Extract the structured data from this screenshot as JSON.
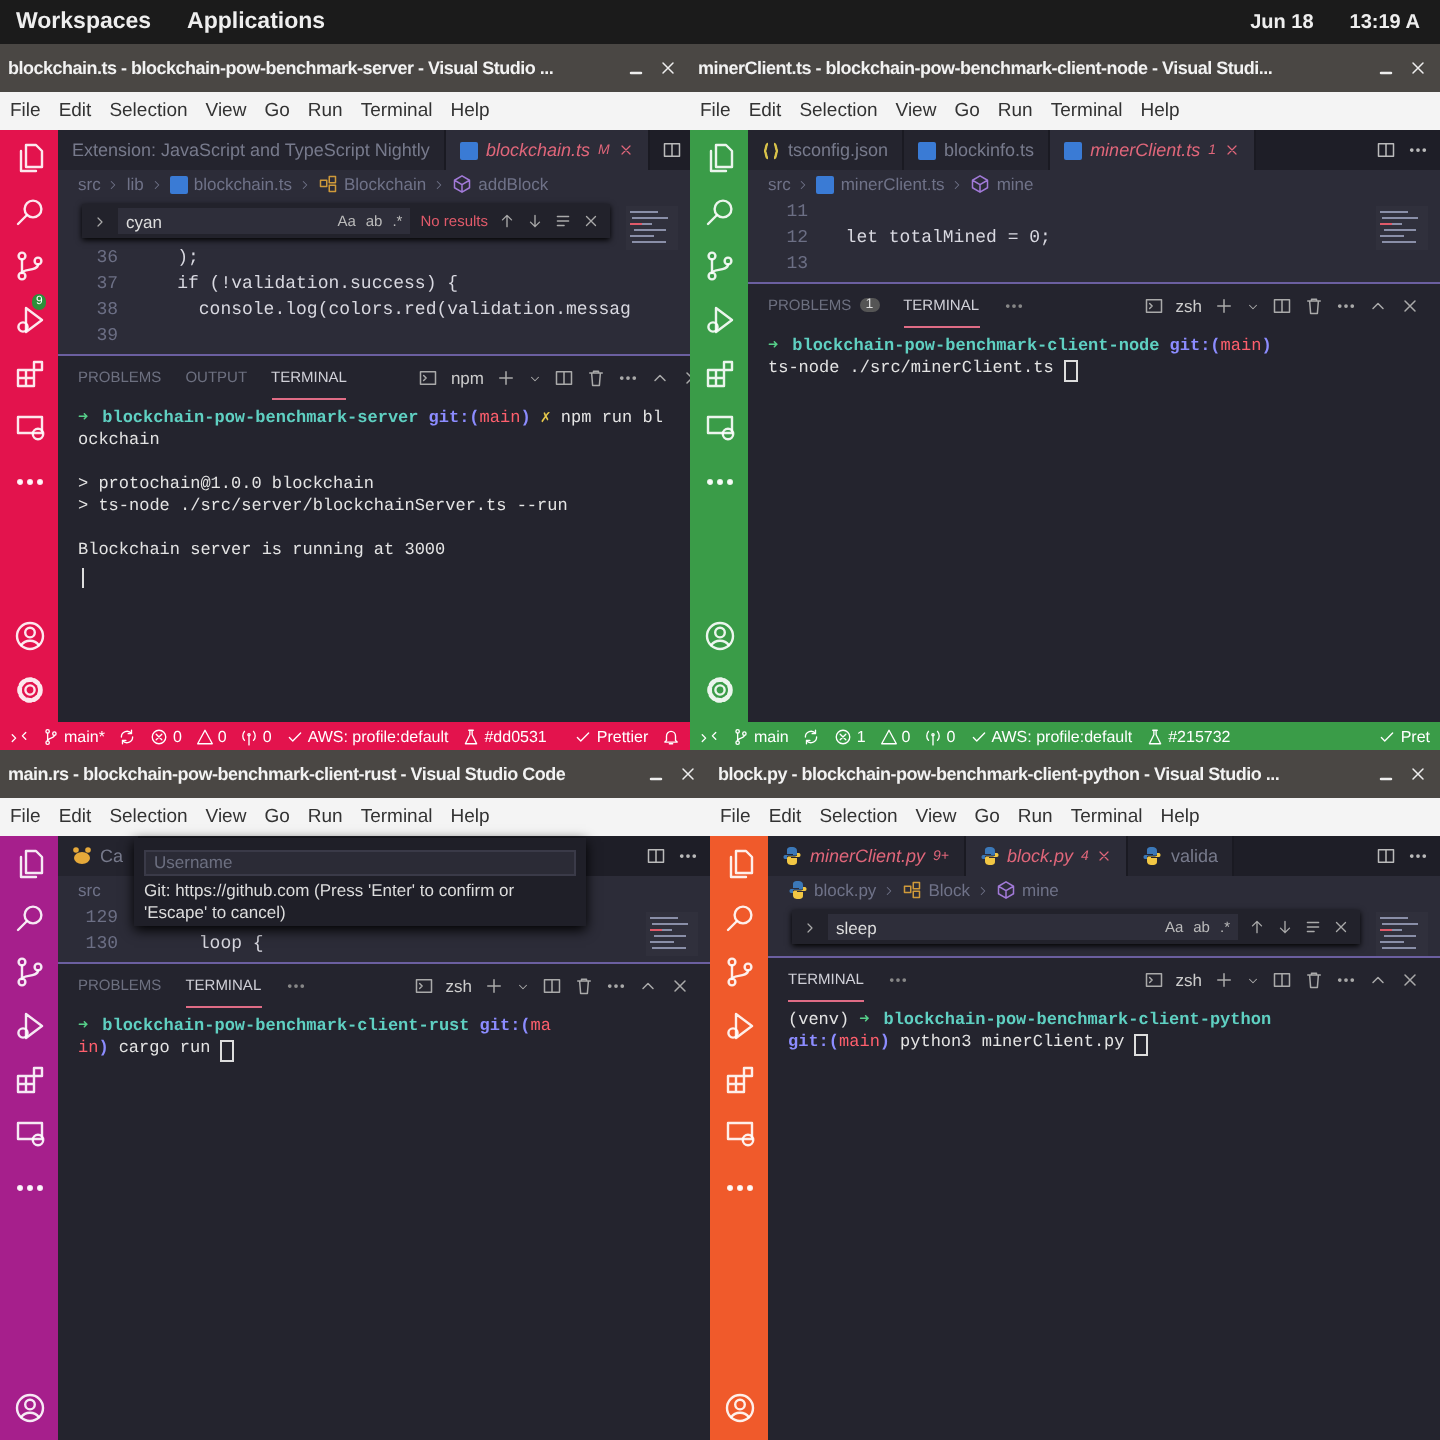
{
  "top_bar": {
    "menus": [
      "Workspaces",
      "Applications"
    ],
    "date": "Jun 18",
    "time": "13:19 A"
  },
  "windows": [
    {
      "title": "blockchain.ts - blockchain-pow-benchmark-server - Visual Studio ...",
      "color": "#e3134d",
      "menu": [
        "File",
        "Edit",
        "Selection",
        "View",
        "Go",
        "Run",
        "Terminal",
        "Help"
      ],
      "scm_badge": "9",
      "editor": {
        "tabs": [
          {
            "label": "Extension: JavaScript and TypeScript Nightly",
            "kind": "ext",
            "selected": false
          },
          {
            "label": "blockchain.ts",
            "kind": "ts",
            "badge": "M",
            "selected": true
          }
        ],
        "breadcrumb": [
          {
            "text": "src"
          },
          {
            "text": "lib"
          },
          {
            "text": "blockchain.ts",
            "kind": "ts"
          },
          {
            "text": "Blockchain",
            "kind": "class"
          },
          {
            "text": "addBlock",
            "kind": "method"
          }
        ],
        "find": {
          "value": "cyan",
          "options": [
            "Aa",
            "ab",
            ".*"
          ],
          "status": "No results"
        },
        "lines": [
          {
            "number": "36",
            "text": "    );"
          },
          {
            "number": "37",
            "text": "    if (!validation.success) {"
          },
          {
            "number": "38",
            "text": "      console.log(colors.red(validation.messag"
          },
          {
            "number": "39"
          }
        ]
      },
      "panel": {
        "tabs": [
          {
            "label": "PROBLEMS",
            "selected": false
          },
          {
            "label": "OUTPUT",
            "selected": false
          },
          {
            "label": "TERMINAL",
            "selected": true
          }
        ],
        "shell": "npm",
        "terminal": [
          {
            "kind": "output",
            "cursor": false,
            "segments": [
              {
                "kind": "arrow",
                "text": "➜"
              },
              {
                "kind": "dir",
                "text": "blockchain-pow-benchmark-server"
              },
              {
                "kind": "git",
                "text": "git:("
              },
              {
                "kind": "branch",
                "text": "main"
              },
              {
                "kind": "git",
                "text": ")"
              },
              {
                "kind": "dirty",
                "text": "✗"
              },
              {
                "kind": "text",
                "text": "npm run bl"
              }
            ]
          },
          {
            "kind": "output",
            "cursor": false,
            "segments": [
              {
                "kind": "text",
                "text": "ockchain"
              }
            ]
          },
          {
            "kind": "blank"
          },
          {
            "kind": "output",
            "cursor": false,
            "segments": [
              {
                "kind": "text",
                "text": "> protochain@1.0.0 blockchain"
              }
            ]
          },
          {
            "kind": "output",
            "cursor": false,
            "segments": [
              {
                "kind": "text",
                "text": "> ts-node ./src/server/blockchainServer.ts --run"
              }
            ]
          },
          {
            "kind": "blank"
          },
          {
            "kind": "output",
            "cursor": false,
            "segments": [
              {
                "kind": "text",
                "text": "Blockchain server is running at 3000"
              }
            ]
          },
          {
            "kind": "cursor"
          }
        ]
      },
      "status": {
        "left": [
          {
            "kind": "remote"
          },
          {
            "kind": "branch",
            "text": "main*"
          },
          {
            "kind": "sync"
          },
          {
            "kind": "errors",
            "text": "0"
          },
          {
            "kind": "warnings",
            "text": "0"
          },
          {
            "kind": "ports",
            "text": "0"
          },
          {
            "kind": "check",
            "text": "AWS: profile:default"
          },
          {
            "kind": "flask",
            "text": "#dd0531"
          }
        ],
        "right": [
          {
            "kind": "check",
            "text": "Prettier"
          },
          {
            "kind": "bell"
          }
        ]
      }
    },
    {
      "title": "minerClient.ts - blockchain-pow-benchmark-client-node - Visual Studi...",
      "color": "#3a9c48",
      "menu": [
        "File",
        "Edit",
        "Selection",
        "View",
        "Go",
        "Run",
        "Terminal",
        "Help"
      ],
      "editor": {
        "tabs": [
          {
            "label": "tsconfig.json",
            "kind": "json",
            "selected": false
          },
          {
            "label": "blockinfo.ts",
            "kind": "ts",
            "selected": false
          },
          {
            "label": "minerClient.ts",
            "kind": "ts",
            "badge": "1",
            "selected": true
          }
        ],
        "breadcrumb": [
          {
            "text": "src"
          },
          {
            "text": "minerClient.ts",
            "kind": "ts"
          },
          {
            "text": "mine",
            "kind": "method"
          }
        ],
        "lines": [
          {
            "number": "11"
          },
          {
            "number": "12",
            "text": "  let totalMined = 0;"
          },
          {
            "number": "13"
          }
        ]
      },
      "panel": {
        "tabs": [
          {
            "label": "PROBLEMS",
            "badge": "1",
            "selected": false
          },
          {
            "label": "TERMINAL",
            "selected": true
          }
        ],
        "shell": "zsh",
        "terminal": [
          {
            "kind": "output",
            "cursor": false,
            "segments": [
              {
                "kind": "arrow",
                "text": "➜"
              },
              {
                "kind": "dir",
                "text": "blockchain-pow-benchmark-client-node"
              },
              {
                "kind": "git",
                "text": "git:("
              },
              {
                "kind": "branch",
                "text": "main"
              },
              {
                "kind": "git",
                "text": ")"
              }
            ]
          },
          {
            "kind": "output",
            "cursor": true,
            "segments": [
              {
                "kind": "text",
                "text": "ts-node ./src/minerClient.ts"
              }
            ]
          }
        ]
      },
      "status": {
        "left": [
          {
            "kind": "remote"
          },
          {
            "kind": "branch",
            "text": "main"
          },
          {
            "kind": "sync"
          },
          {
            "kind": "errors",
            "text": "1"
          },
          {
            "kind": "warnings",
            "text": "0"
          },
          {
            "kind": "ports",
            "text": "0"
          },
          {
            "kind": "check",
            "text": "AWS: profile:default"
          },
          {
            "kind": "flask",
            "text": "#215732"
          }
        ],
        "right": [
          {
            "kind": "check",
            "text": "Pret"
          }
        ]
      }
    },
    {
      "title": "main.rs - blockchain-pow-benchmark-client-rust - Visual Studio Code",
      "color": "#a61f8c",
      "menu": [
        "File",
        "Edit",
        "Selection",
        "View",
        "Go",
        "Run",
        "Terminal",
        "Help"
      ],
      "editor": {
        "tabs": [
          {
            "label": "Ca",
            "kind": "rust",
            "selected": false
          }
        ],
        "breadcrumb": [
          {
            "text": "src"
          }
        ],
        "lines": [
          {
            "number": "129"
          },
          {
            "number": "130",
            "text": "      loop {"
          }
        ]
      },
      "overlay": {
        "placeholder": "Username",
        "message": "Git: https://github.com (Press 'Enter' to confirm or 'Escape' to cancel)"
      },
      "panel": {
        "tabs": [
          {
            "label": "PROBLEMS",
            "selected": false
          },
          {
            "label": "TERMINAL",
            "selected": true
          }
        ],
        "shell": "zsh",
        "terminal": [
          {
            "kind": "output",
            "cursor": false,
            "segments": [
              {
                "kind": "arrow",
                "text": "➜"
              },
              {
                "kind": "dir",
                "text": "blockchain-pow-benchmark-client-rust"
              },
              {
                "kind": "git",
                "text": "git:("
              },
              {
                "kind": "branch",
                "text": "ma"
              }
            ]
          },
          {
            "kind": "output",
            "cursor": true,
            "segments": [
              {
                "kind": "branch",
                "text": "in"
              },
              {
                "kind": "git",
                "text": ")"
              },
              {
                "kind": "text",
                "text": "cargo run"
              }
            ]
          }
        ]
      }
    },
    {
      "title": "block.py - blockchain-pow-benchmark-client-python - Visual Studio ...",
      "color": "#f05a2b",
      "menu": [
        "File",
        "Edit",
        "Selection",
        "View",
        "Go",
        "Run",
        "Terminal",
        "Help"
      ],
      "editor": {
        "tabs": [
          {
            "label": "minerClient.py",
            "kind": "py",
            "badge": "9+",
            "selected": false
          },
          {
            "label": "block.py",
            "kind": "py",
            "badge": "4",
            "selected": true
          },
          {
            "label": "valida",
            "kind": "py",
            "selected": false
          }
        ],
        "breadcrumb": [
          {
            "text": "block.py",
            "kind": "py"
          },
          {
            "text": "Block",
            "kind": "class"
          },
          {
            "text": "mine",
            "kind": "method"
          }
        ],
        "find": {
          "value": "sleep",
          "options": [
            "Aa",
            "ab",
            ".*"
          ]
        }
      },
      "panel": {
        "tabs": [
          {
            "label": "TERMINAL",
            "selected": true
          }
        ],
        "shell": "zsh",
        "terminal": [
          {
            "kind": "output",
            "cursor": false,
            "segments": [
              {
                "kind": "text",
                "text": "(venv)"
              },
              {
                "kind": "arrow",
                "text": "➜"
              },
              {
                "kind": "dir",
                "text": "blockchain-pow-benchmark-client-python"
              }
            ]
          },
          {
            "kind": "output",
            "cursor": true,
            "segments": [
              {
                "kind": "git",
                "text": "git:("
              },
              {
                "kind": "branch",
                "text": "main"
              },
              {
                "kind": "git",
                "text": ")"
              },
              {
                "kind": "text",
                "text": "python3 minerClient.py"
              }
            ]
          }
        ]
      }
    }
  ]
}
